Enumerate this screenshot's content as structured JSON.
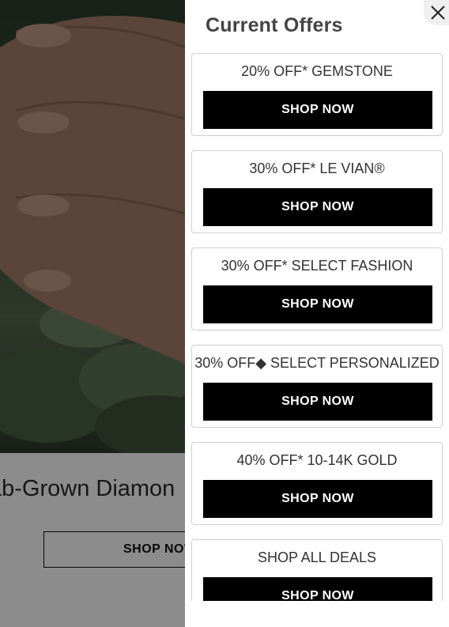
{
  "background": {
    "caption": "ab-Grown Diamon",
    "shop_label": "SHOP NOW"
  },
  "drawer": {
    "title": "Current Offers",
    "close_icon": "close-icon",
    "offers": [
      {
        "title": "20% OFF* GEMSTONE",
        "button": "SHOP NOW"
      },
      {
        "title": "30% OFF* LE VIAN®",
        "button": "SHOP NOW"
      },
      {
        "title": "30% OFF* SELECT FASHION",
        "button": "SHOP NOW"
      },
      {
        "title": "30% OFF◆ SELECT PERSONALIZED",
        "button": "SHOP NOW"
      },
      {
        "title": "40% OFF* 10-14K GOLD",
        "button": "SHOP NOW"
      },
      {
        "title": "SHOP ALL DEALS",
        "button": "SHOP NOW"
      }
    ]
  },
  "colors": {
    "button_bg": "#000000",
    "overlay": "rgba(0,0,0,0.45)"
  }
}
